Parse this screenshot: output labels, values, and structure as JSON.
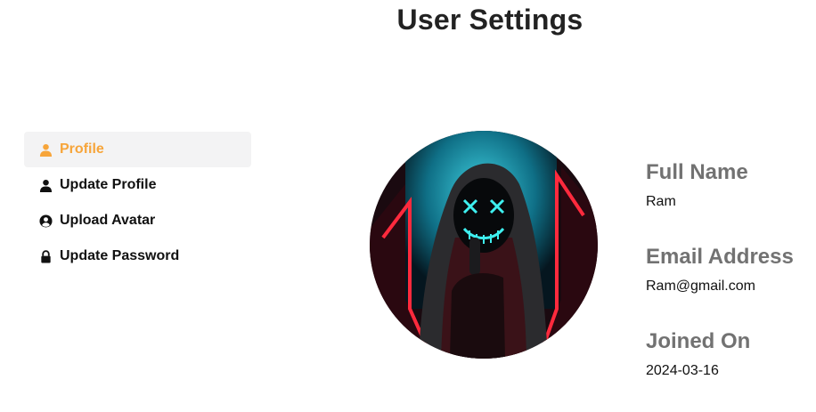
{
  "page": {
    "title": "User Settings"
  },
  "sidebar": {
    "items": [
      {
        "label": "Profile",
        "icon": "user-icon",
        "active": true
      },
      {
        "label": "Update Profile",
        "icon": "user-icon",
        "active": false
      },
      {
        "label": "Upload Avatar",
        "icon": "user-circle-icon",
        "active": false
      },
      {
        "label": "Update Password",
        "icon": "lock-icon",
        "active": false
      }
    ]
  },
  "profile": {
    "avatar_icon": "avatar-image",
    "full_name_label": "Full Name",
    "full_name_value": "Ram",
    "email_label": "Email Address",
    "email_value": "Ram@gmail.com",
    "joined_label": "Joined On",
    "joined_value": "2024-03-16"
  },
  "colors": {
    "accent": "#f7a53a",
    "active_bg": "#f3f3f4",
    "label_gray": "#727272"
  }
}
